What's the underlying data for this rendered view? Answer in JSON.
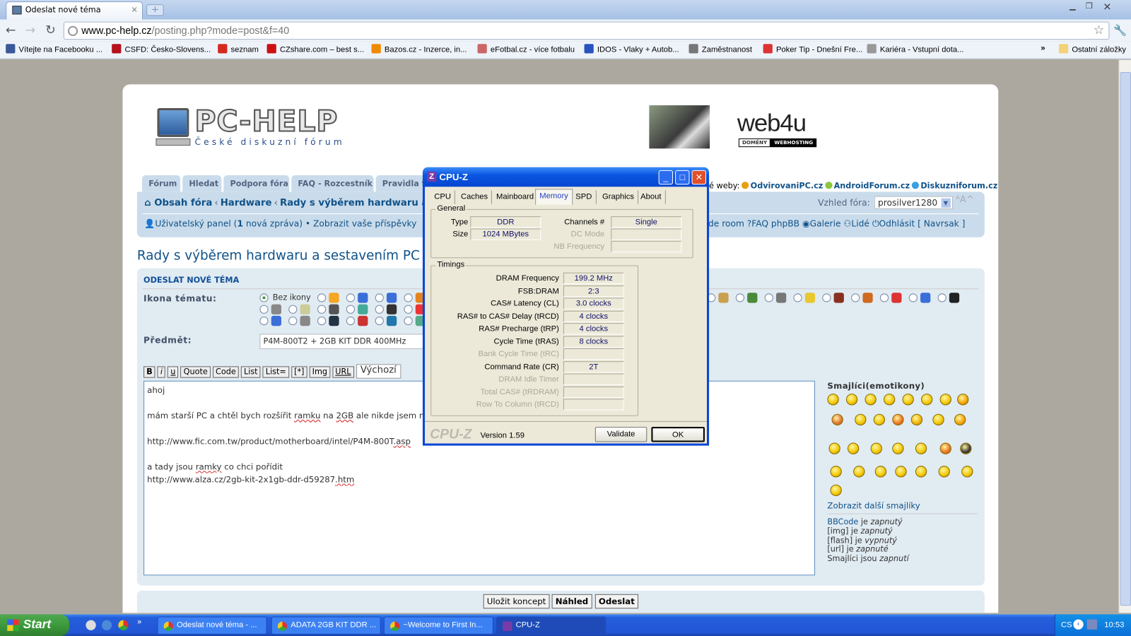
{
  "browser": {
    "tab_title": "Odeslat nové téma",
    "url_domain": "www.pc-help.cz",
    "url_path": "/posting.php?mode=post&f=40",
    "bookmarks": [
      {
        "label": "Vítejte na Facebooku ...",
        "color": "#3b5998"
      },
      {
        "label": "CSFD: Česko-Slovens...",
        "color": "#b5121b"
      },
      {
        "label": "seznam",
        "color": "#d52b1e"
      },
      {
        "label": "CZshare.com – best s...",
        "color": "#cc1111"
      },
      {
        "label": "Bazos.cz - Inzerce, in...",
        "color": "#f08a00"
      },
      {
        "label": "eFotbal.cz - více fotbalu",
        "color": "#c66"
      },
      {
        "label": "IDOS - Vlaky + Autob...",
        "color": "#2a52be"
      },
      {
        "label": "Zaměstnanost",
        "color": "#777"
      },
      {
        "label": "Poker Tip - Dnešní Fre...",
        "color": "#d33"
      },
      {
        "label": "Kariéra - Vstupní dota...",
        "color": "#999"
      }
    ],
    "overflow": "»",
    "other_bookmarks": "Ostatní záložky"
  },
  "forum": {
    "logo_text": "PC-HELP",
    "logo_subtitle": "České diskuzní fórum",
    "ad_brand": "web4u",
    "ad_tags": [
      "DOMÉNY",
      "WEBHOSTING"
    ],
    "nav_tabs": [
      "Fórum",
      "Hledat",
      "Podpora fóra",
      "FAQ - Rozcestník",
      "Pravidla fó"
    ],
    "other_sites_label": "é weby:",
    "other_sites": [
      {
        "label": "OdvirovaniPC.cz",
        "color": "#e8a010"
      },
      {
        "label": "AndroidForum.cz",
        "color": "#8cc63f"
      },
      {
        "label": "Diskuzniforum.cz",
        "color": "#3aa0e0"
      }
    ],
    "breadcrumb": [
      "Obsah fóra",
      "Hardware",
      "Rady s výběrem hardwaru a sest"
    ],
    "style_label": "Vzhled fóra:",
    "style_value": "prosilver1280",
    "font_size_ctrl": "ᴬA^",
    "user_panel": "Uživatelský panel",
    "new_messages_count": "1",
    "new_messages_text": "nová zpráva",
    "own_posts": "Zobrazit vaše příspěvky",
    "user_links": [
      "de room",
      "FAQ phpBB",
      "Galerie",
      "Lidé",
      "Odhlásit [ Navrsak ]"
    ],
    "page_title": "Rady s výběrem hardwaru a sestavením PC"
  },
  "post": {
    "header": "Odeslat nové téma",
    "icon_label": "Ikona tématu:",
    "no_icon": "Bez ikony",
    "topic_icons": [
      "#f5a623",
      "#3a6fd8",
      "#3a6fd8",
      "#e8821e",
      "#c9a050",
      "#4a8a3a",
      "#777",
      "#e8c830",
      "#8a3020",
      "#d06a20",
      "#d33",
      "#3a6fd8",
      "#222",
      "#888",
      "#cc9",
      "#555",
      "#4a9",
      "#333",
      "#e33",
      "#3a6fd8",
      "#556",
      "#777",
      "#4a7",
      "#c90",
      "#39c",
      "#a55",
      "#3a6fd8",
      "#888",
      "#234",
      "#c33",
      "#27a",
      "#5a8",
      "#345",
      "#666",
      "#ea3",
      "#c44",
      "#8ab",
      "#333",
      "#5a5"
    ],
    "subject_label": "Předmět:",
    "subject_value": "P4M-800T2 + 2GB KIT DDR 400MHz",
    "format_buttons": [
      "B",
      "i",
      "u",
      "Quote",
      "Code",
      "List",
      "List=",
      "[*]",
      "Img",
      "URL"
    ],
    "font_dropdown": "Výchozí",
    "body_lines": [
      "ahoj",
      "",
      "mám starší PC a chtěl bych rozšířit ramku na 2GB ale nikde jsem n",
      "",
      "http://www.fic.com.tw/product/motherboard/intel/P4M-800T.asp",
      "",
      "a tady jsou ramky co chci pořídit",
      "http://www.alza.cz/2gb-kit-2x1gb-ddr-d59287.htm"
    ],
    "smilies_title": "Smajlíci(emotikony)",
    "smiley_colors": [
      "#f2c600",
      "#f2c600",
      "#f2c600",
      "#f2c600",
      "#f2c600",
      "#f2c600",
      "#f2c600",
      "#f2a000",
      "#e07030",
      "#f2c600",
      "#f2c600",
      "#f07020",
      "#f2b000",
      "#f2c600",
      "#f2a000",
      "#f2c600",
      "#f2c600",
      "#f2c600",
      "#f2c600",
      "#f2c600",
      "#e87020",
      "#333",
      "#f2c600",
      "#f2c600",
      "#f2c600",
      "#f2c600",
      "#f2c600",
      "#f2c600",
      "#f2c600",
      "#f2c600",
      "#f2c600",
      "#f2c600"
    ],
    "more_smilies": "Zobrazit další smajlíky",
    "bbinfo": [
      {
        "name": "BBCode",
        "mid": " je ",
        "state": "zapnutý"
      },
      {
        "name": "[img]",
        "mid": " je ",
        "state": "zapnutý"
      },
      {
        "name": "[flash]",
        "mid": " je ",
        "state": "vypnutý"
      },
      {
        "name": "[url]",
        "mid": " je ",
        "state": "zapnuté"
      },
      {
        "name": "Smajlíci",
        "mid": " jsou ",
        "state": "zapnutí"
      }
    ],
    "save_draft": "Uložit koncept",
    "preview": "Náhled",
    "submit": "Odeslat"
  },
  "cpuz": {
    "title": "CPU-Z",
    "tabs": [
      "CPU",
      "Caches",
      "Mainboard",
      "Memory",
      "SPD",
      "Graphics",
      "About"
    ],
    "active_tab": "Memory",
    "general_label": "General",
    "type_label": "Type",
    "type_value": "DDR",
    "size_label": "Size",
    "size_value": "1024 MBytes",
    "channels_label": "Channels #",
    "channels_value": "Single",
    "dc_mode_label": "DC Mode",
    "nb_freq_label": "NB Frequency",
    "timings_label": "Timings",
    "timings": [
      {
        "label": "DRAM Frequency",
        "value": "199.2 MHz"
      },
      {
        "label": "FSB:DRAM",
        "value": "2:3"
      },
      {
        "label": "CAS# Latency (CL)",
        "value": "3.0 clocks"
      },
      {
        "label": "RAS# to CAS# Delay (tRCD)",
        "value": "4 clocks"
      },
      {
        "label": "RAS# Precharge (tRP)",
        "value": "4 clocks"
      },
      {
        "label": "Cycle Time (tRAS)",
        "value": "8 clocks"
      },
      {
        "label": "Bank Cycle Time (tRC)",
        "value": ""
      },
      {
        "label": "Command Rate (CR)",
        "value": "2T"
      },
      {
        "label": "DRAM Idle Timer",
        "value": ""
      },
      {
        "label": "Total CAS# (tRDRAM)",
        "value": ""
      },
      {
        "label": "Row To Column (tRCD)",
        "value": ""
      }
    ],
    "logo": "CPU-Z",
    "version": "Version 1.59",
    "validate": "Validate",
    "ok": "OK"
  },
  "taskbar": {
    "start": "Start",
    "tasks": [
      {
        "label": "Odeslat nové téma - ...",
        "active": false
      },
      {
        "label": "ADATA 2GB KIT DDR ...",
        "active": false
      },
      {
        "label": "~Welcome to First In...",
        "active": false
      },
      {
        "label": "CPU-Z",
        "active": true
      }
    ],
    "lang": "CS",
    "clock": "10:53"
  }
}
